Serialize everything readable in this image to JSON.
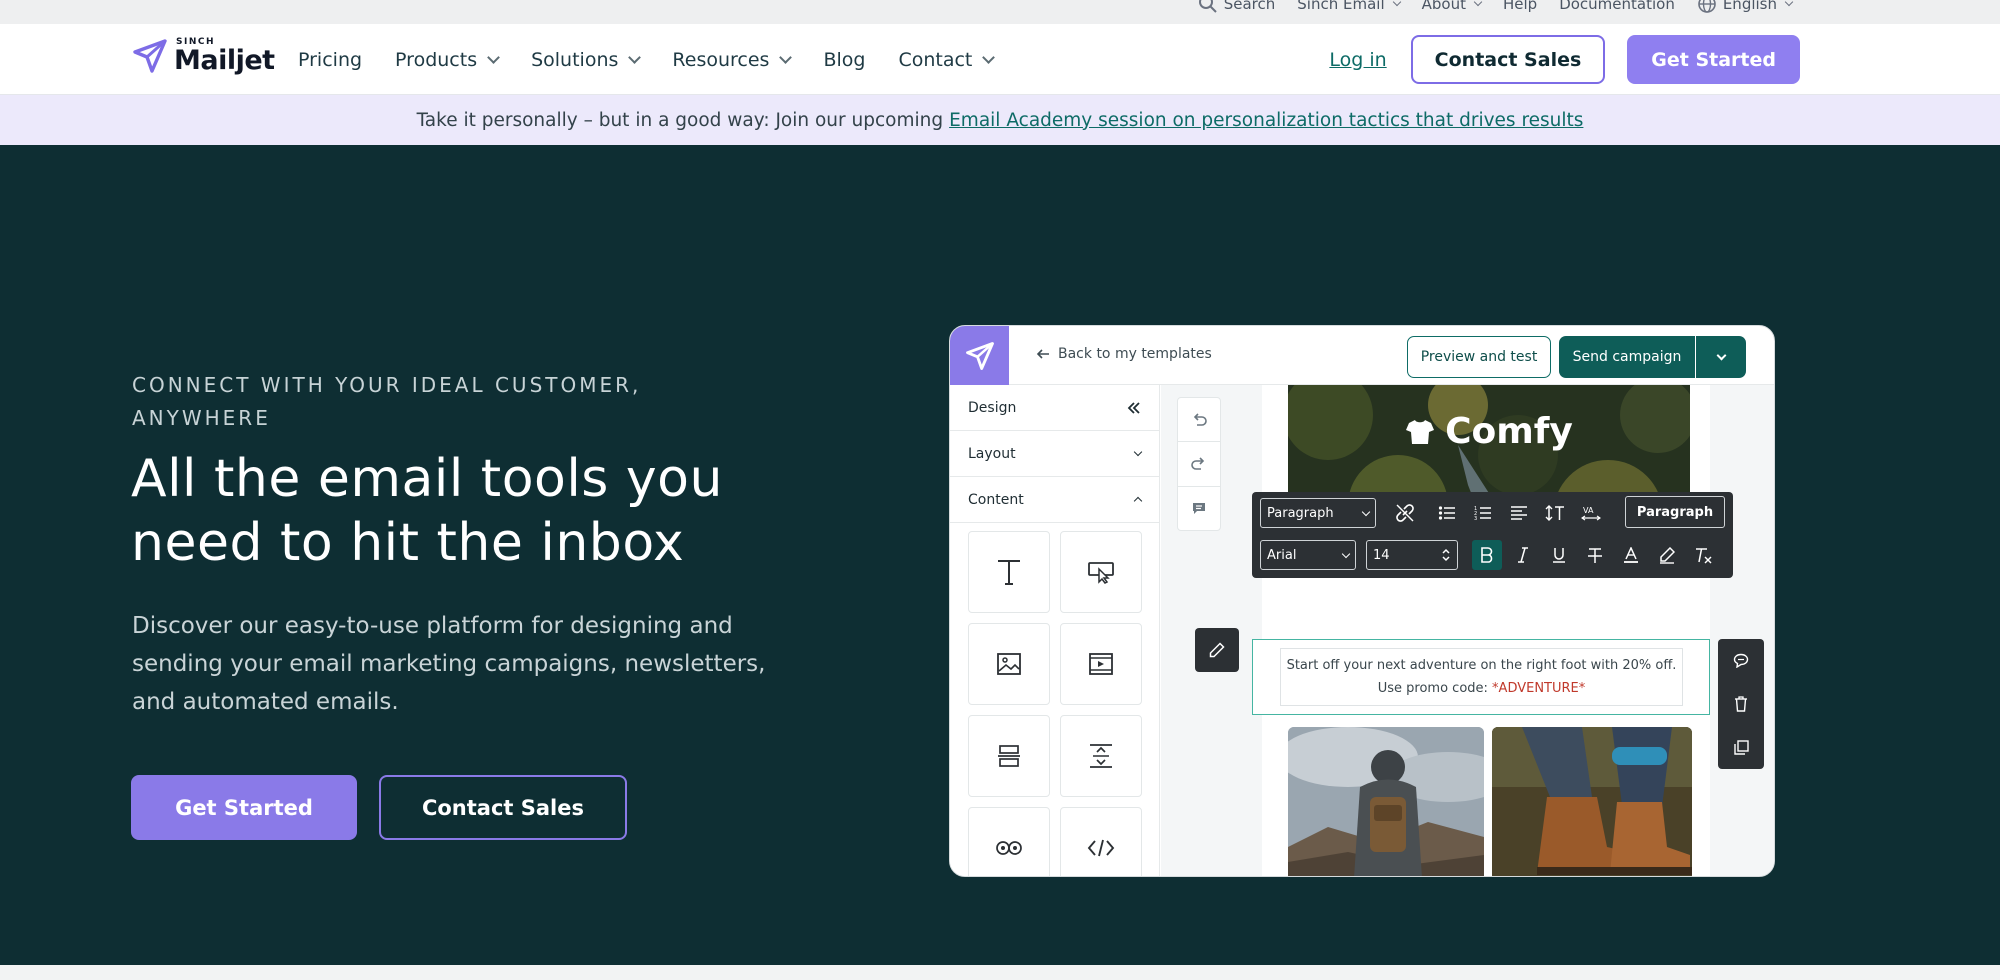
{
  "utility": {
    "search": "Search",
    "sinch_email": "Sinch Email",
    "about": "About",
    "help": "Help",
    "documentation": "Documentation",
    "language": "English"
  },
  "nav": {
    "logo_top": "SINCH",
    "logo_main": "Mailjet",
    "links": [
      {
        "label": "Pricing"
      },
      {
        "label": "Products"
      },
      {
        "label": "Solutions"
      },
      {
        "label": "Resources"
      },
      {
        "label": "Blog"
      },
      {
        "label": "Contact"
      }
    ],
    "login": "Log in",
    "contact_sales": "Contact Sales",
    "get_started": "Get Started"
  },
  "banner": {
    "text": "Take it personally – but in a good way: Join our upcoming",
    "link": "Email Academy session on personalization tactics that drives results"
  },
  "hero": {
    "eyebrow": "CONNECT WITH YOUR IDEAL CUSTOMER, ANYWHERE",
    "headline": "All the email tools you need to hit the inbox",
    "subtitle": "Discover our easy-to-use platform for designing and sending your email marketing campaigns, newsletters, and automated emails.",
    "primary_cta": "Get Started",
    "secondary_cta": "Contact Sales"
  },
  "editor": {
    "back": "Back to my templates",
    "preview": "Preview and test",
    "send": "Send campaign",
    "panel": {
      "design": "Design",
      "layout": "Layout",
      "content": "Content"
    },
    "brand": "Comfy",
    "toolbar": {
      "block_style": "Paragraph",
      "font": "Arial",
      "size": "14",
      "style_button": "Paragraph"
    },
    "text_line1": "Start off your next adventure on the right foot with 20% off.",
    "text_line2": "Use promo code:",
    "promo_code": "*ADVENTURE*"
  },
  "colors": {
    "brand_purple": "#8a7ae8",
    "hero_bg": "#0e2e33",
    "teal": "#0e5d58"
  }
}
